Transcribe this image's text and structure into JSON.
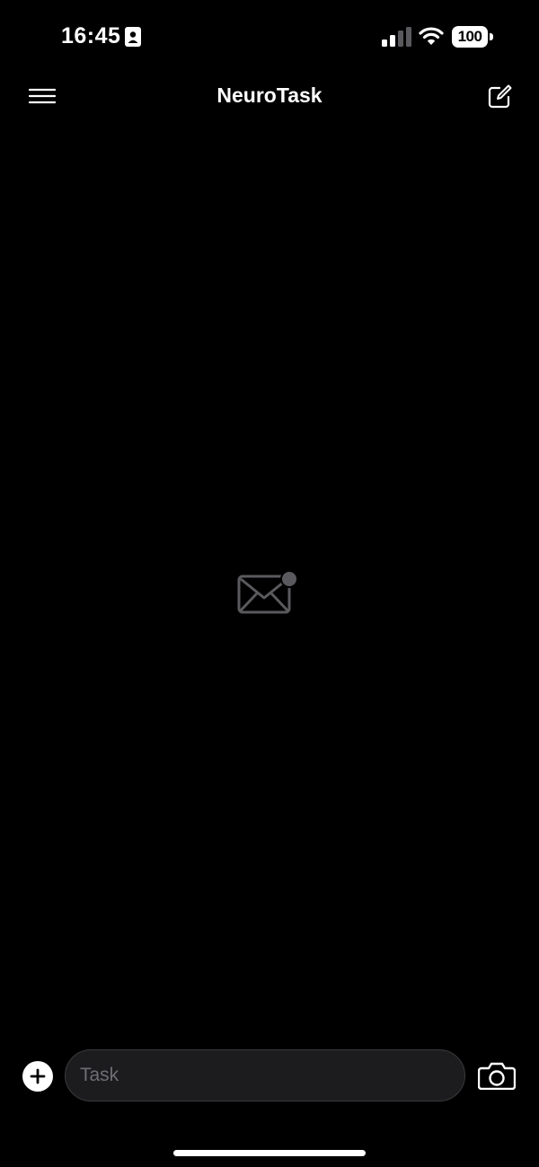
{
  "status_bar": {
    "time": "16:45",
    "battery_level": "100",
    "icons": [
      "id-card-icon",
      "cellular-signal-icon",
      "wifi-icon",
      "battery-icon"
    ]
  },
  "header": {
    "title": "NeuroTask",
    "left_icon": "hamburger-menu-icon",
    "right_icon": "compose-icon"
  },
  "empty_state": {
    "icon": "mail-notification-icon"
  },
  "composer": {
    "add_icon": "plus-icon",
    "input_value": "",
    "input_placeholder": "Task",
    "camera_icon": "camera-icon"
  },
  "colors": {
    "background": "#000000",
    "foreground": "#ffffff",
    "input_background": "#1c1c1e",
    "input_border": "#3a3a3c",
    "placeholder": "#6e6e73",
    "muted_icon": "#5a5a5e"
  }
}
